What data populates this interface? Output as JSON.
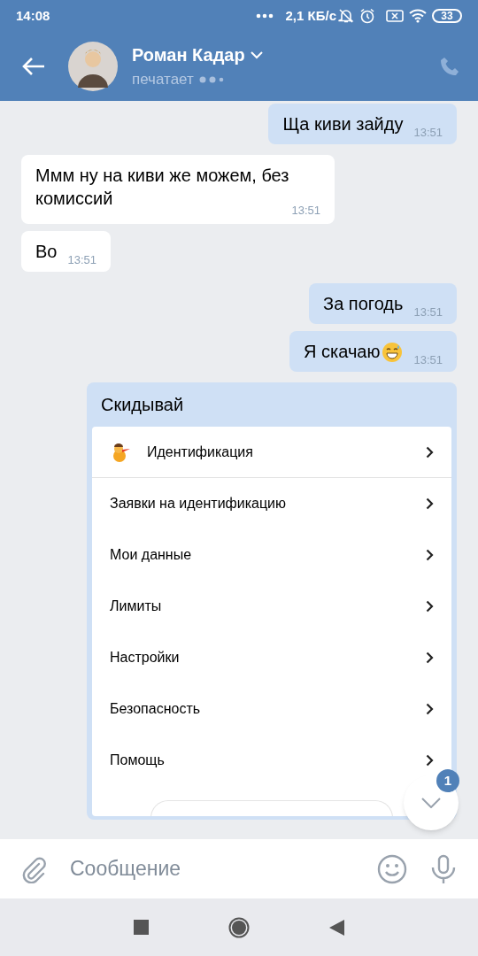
{
  "status_bar": {
    "time": "14:08",
    "speed": "2,1 КБ/с",
    "battery": "33"
  },
  "header": {
    "name": "Роман Кадар",
    "status": "печатает"
  },
  "messages": [
    {
      "kind": "outgoing",
      "text": "Ща киви зайду",
      "time": "13:51"
    },
    {
      "kind": "incoming",
      "text": "Ммм ну на киви же можем, без комиссий",
      "time": "13:51"
    },
    {
      "kind": "incoming",
      "text": "Во",
      "time": "13:51"
    },
    {
      "kind": "outgoing",
      "text": "За погодь",
      "time": "13:51"
    },
    {
      "kind": "outgoing",
      "text": "Я скачаю",
      "time": "13:51",
      "emoji": true
    },
    {
      "kind": "card",
      "title": "Скидывай",
      "items": [
        {
          "kind": "with-icon",
          "label": "Идентификация"
        },
        {
          "kind": "plain",
          "label": "Заявки на идентификацию"
        },
        {
          "kind": "plain",
          "label": "Мои данные"
        },
        {
          "kind": "plain",
          "label": "Лимиты"
        },
        {
          "kind": "plain",
          "label": "Настройки"
        },
        {
          "kind": "plain",
          "label": "Безопасность"
        },
        {
          "kind": "plain",
          "label": "Помощь"
        }
      ]
    }
  ],
  "scroll_button": {
    "badge": "1"
  },
  "composer": {
    "placeholder": "Сообщение"
  }
}
